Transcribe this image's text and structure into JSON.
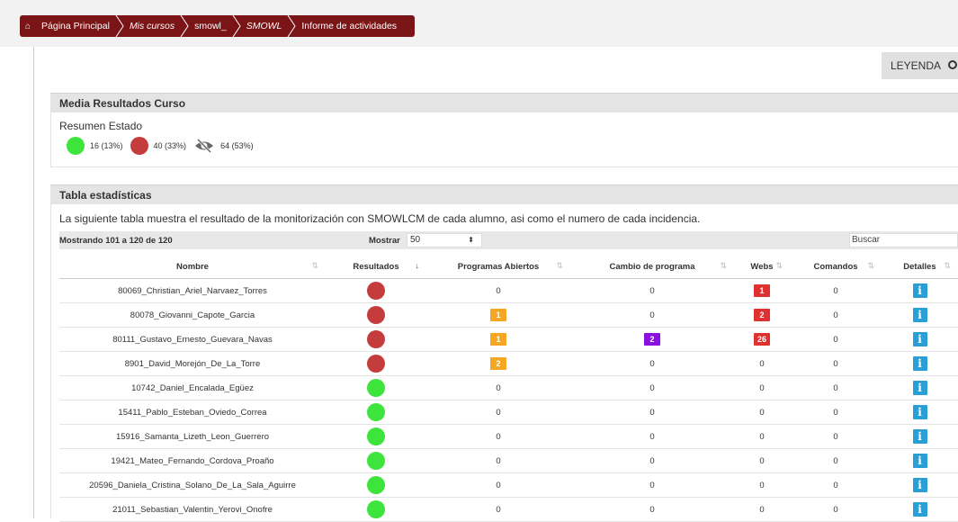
{
  "breadcrumb": [
    {
      "label": "Página Principal",
      "italic": false
    },
    {
      "label": "Mis cursos",
      "italic": true
    },
    {
      "label": "smowl_",
      "italic": false
    },
    {
      "label": "SMOWL",
      "italic": true
    },
    {
      "label": "Informe de actividades",
      "italic": false
    }
  ],
  "leyenda": {
    "label": "LEYENDA"
  },
  "media": {
    "title": "Media Resultados Curso",
    "resumen_label": "Resumen Estado",
    "ok_count": "16 (13%)",
    "fail_count": "40 (33%)",
    "hidden_count": "64 (53%)"
  },
  "tabla": {
    "title": "Tabla estadísticas",
    "description": "La siguiente tabla muestra el resultado de la monitorización con SMOWLCM de cada alumno, asi como el numero de cada incidencia.",
    "mostrando": "Mostrando 101 a 120 de 120",
    "mostrar_label": "Mostrar",
    "mostrar_value": "50",
    "buscar_placeholder": "Buscar",
    "columns": [
      "Nombre",
      "Resultados",
      "Programas Abiertos",
      "Cambio de programa",
      "Webs",
      "Comandos",
      "Detalles"
    ],
    "rows": [
      {
        "nombre": "80069_Christian_Ariel_Narvaez_Torres",
        "resultado": "red",
        "programas": "0",
        "cambio": "0",
        "webs": "1",
        "comandos": "0"
      },
      {
        "nombre": "80078_Giovanni_Capote_Garcia",
        "resultado": "red",
        "programas": "1",
        "cambio": "0",
        "webs": "2",
        "comandos": "0"
      },
      {
        "nombre": "80111_Gustavo_Ernesto_Guevara_Navas",
        "resultado": "red",
        "programas": "1",
        "cambio": "2",
        "webs": "26",
        "comandos": "0"
      },
      {
        "nombre": "8901_David_Morejón_De_La_Torre",
        "resultado": "red",
        "programas": "2",
        "cambio": "0",
        "webs": "0",
        "comandos": "0"
      },
      {
        "nombre": "10742_Daniel_Encalada_Egüez",
        "resultado": "green",
        "programas": "0",
        "cambio": "0",
        "webs": "0",
        "comandos": "0"
      },
      {
        "nombre": "15411_Pablo_Esteban_Oviedo_Correa",
        "resultado": "green",
        "programas": "0",
        "cambio": "0",
        "webs": "0",
        "comandos": "0"
      },
      {
        "nombre": "15916_Samanta_Lizeth_Leon_Guerrero",
        "resultado": "green",
        "programas": "0",
        "cambio": "0",
        "webs": "0",
        "comandos": "0"
      },
      {
        "nombre": "19421_Mateo_Fernando_Cordova_Proaño",
        "resultado": "green",
        "programas": "0",
        "cambio": "0",
        "webs": "0",
        "comandos": "0"
      },
      {
        "nombre": "20596_Daniela_Cristina_Solano_De_La_Sala_Aguirre",
        "resultado": "green",
        "programas": "0",
        "cambio": "0",
        "webs": "0",
        "comandos": "0"
      },
      {
        "nombre": "21011_Sebastian_Valentin_Yerovi_Onofre",
        "resultado": "green",
        "programas": "0",
        "cambio": "0",
        "webs": "0",
        "comandos": "0"
      }
    ]
  },
  "colors": {
    "breadcrumb": "#7a1416",
    "ok": "#3ce43c",
    "fail": "#c43c3c",
    "programas": "#f5a623",
    "cambio": "#8a0fe0",
    "webs": "#e03131",
    "info": "#2a9fd6"
  },
  "icons": {
    "home": "home-icon",
    "eye_off": "eye-slash-icon",
    "info": "info-icon",
    "sort": "sort-icon"
  }
}
